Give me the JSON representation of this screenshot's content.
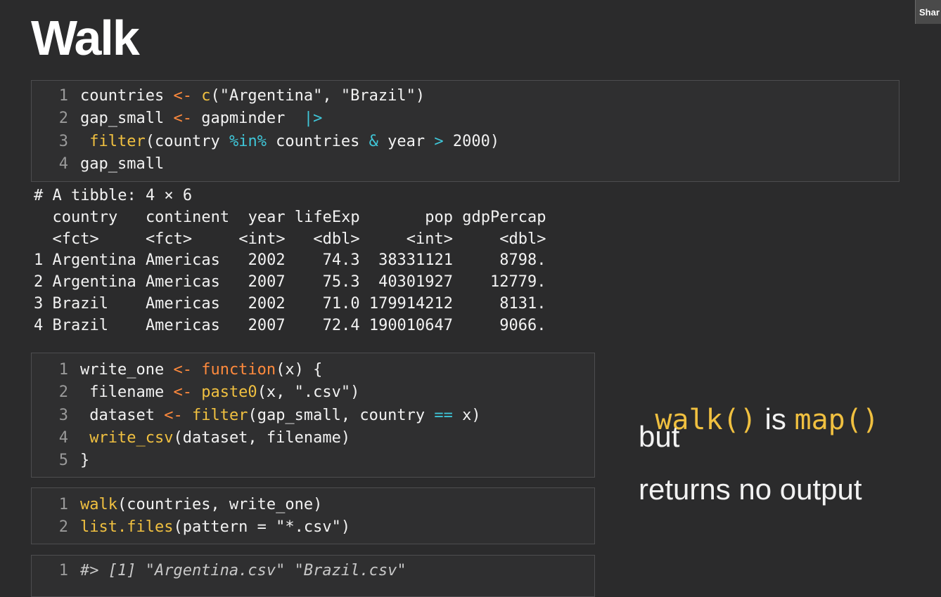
{
  "slide": {
    "title": "Walk",
    "share_label": "Shar"
  },
  "block1": {
    "lines": [
      {
        "n": "1",
        "parts": [
          [
            "countries ",
            ""
          ],
          [
            "<-",
            "kw-orange"
          ],
          [
            " ",
            ""
          ],
          [
            "c",
            "kw-yellow"
          ],
          [
            "(\"Argentina\", \"Brazil\")",
            ""
          ]
        ]
      },
      {
        "n": "2",
        "parts": [
          [
            "gap_small ",
            ""
          ],
          [
            "<-",
            "kw-orange"
          ],
          [
            " gapminder  ",
            ""
          ],
          [
            "|>",
            "kw-cyan"
          ]
        ]
      },
      {
        "n": "3",
        "parts": [
          [
            " ",
            ""
          ],
          [
            "filter",
            "kw-yellow"
          ],
          [
            "(country ",
            ""
          ],
          [
            "%in%",
            "kw-cyan"
          ],
          [
            " countries ",
            ""
          ],
          [
            "&",
            "kw-cyan"
          ],
          [
            " year ",
            ""
          ],
          [
            ">",
            "kw-cyan"
          ],
          [
            " 2000)",
            ""
          ]
        ]
      },
      {
        "n": "4",
        "parts": [
          [
            "gap_small",
            ""
          ]
        ]
      }
    ]
  },
  "tibble": {
    "lines": [
      "# A tibble: 4 × 6",
      "  country   continent  year lifeExp       pop gdpPercap",
      "  <fct>     <fct>     <int>   <dbl>     <int>     <dbl>",
      "1 Argentina Americas   2002    74.3  38331121     8798.",
      "2 Argentina Americas   2007    75.3  40301927    12779.",
      "3 Brazil    Americas   2002    71.0 179914212     8131.",
      "4 Brazil    Americas   2007    72.4 190010647     9066."
    ]
  },
  "block2": {
    "lines": [
      {
        "n": "1",
        "parts": [
          [
            "write_one ",
            ""
          ],
          [
            "<-",
            "kw-orange"
          ],
          [
            " ",
            ""
          ],
          [
            "function",
            "kw-orange"
          ],
          [
            "(x) {",
            ""
          ]
        ]
      },
      {
        "n": "2",
        "parts": [
          [
            " filename ",
            ""
          ],
          [
            "<-",
            "kw-orange"
          ],
          [
            " ",
            ""
          ],
          [
            "paste0",
            "kw-yellow"
          ],
          [
            "(x, \".csv\")",
            ""
          ]
        ]
      },
      {
        "n": "3",
        "parts": [
          [
            " dataset ",
            ""
          ],
          [
            "<-",
            "kw-orange"
          ],
          [
            " ",
            ""
          ],
          [
            "filter",
            "kw-yellow"
          ],
          [
            "(gap_small, country ",
            ""
          ],
          [
            "==",
            "kw-cyan"
          ],
          [
            " x)",
            ""
          ]
        ]
      },
      {
        "n": "4",
        "parts": [
          [
            " ",
            ""
          ],
          [
            "write_csv",
            "kw-yellow"
          ],
          [
            "(dataset, filename)",
            ""
          ]
        ]
      },
      {
        "n": "5",
        "parts": [
          [
            "}",
            ""
          ]
        ]
      }
    ]
  },
  "block3": {
    "lines": [
      {
        "n": "1",
        "parts": [
          [
            "walk",
            "kw-yellow"
          ],
          [
            "(countries, write_one)",
            ""
          ]
        ]
      },
      {
        "n": "2",
        "parts": [
          [
            "list.files",
            "kw-yellow"
          ],
          [
            "(pattern = \"*.csv\")",
            ""
          ]
        ]
      }
    ]
  },
  "block4": {
    "lines": [
      {
        "n": "1",
        "parts": [
          [
            "#> [1] \"Argentina.csv\" \"Brazil.csv\"",
            "comment"
          ]
        ]
      }
    ]
  },
  "sidebar": {
    "walk_fn": "walk()",
    "is_word": " is ",
    "map_fn": "map()",
    "but_word": "but",
    "returns_text": "returns no output"
  }
}
